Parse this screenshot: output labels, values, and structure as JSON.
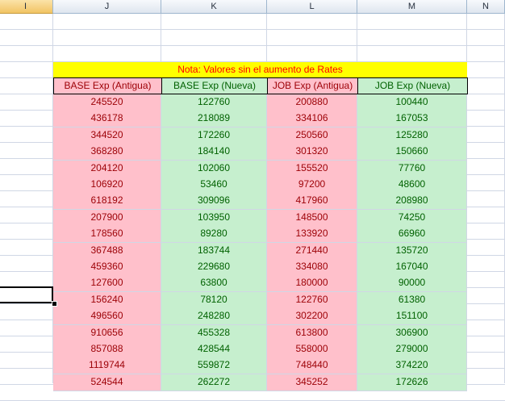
{
  "columns": [
    "I",
    "J",
    "K",
    "L",
    "M",
    "N"
  ],
  "selected_column": "I",
  "note": "Nota: Valores sin el aumento de Rates",
  "headers": [
    "BASE Exp (Antigua)",
    "BASE Exp (Nueva)",
    "JOB Exp (Antigua)",
    "JOB Exp (Nueva)"
  ],
  "rows": [
    [
      "245520",
      "122760",
      "200880",
      "100440"
    ],
    [
      "436178",
      "218089",
      "334106",
      "167053"
    ],
    [
      "344520",
      "172260",
      "250560",
      "125280"
    ],
    [
      "368280",
      "184140",
      "301320",
      "150660"
    ],
    [
      "204120",
      "102060",
      "155520",
      "77760"
    ],
    [
      "106920",
      "53460",
      "97200",
      "48600"
    ],
    [
      "618192",
      "309096",
      "417960",
      "208980"
    ],
    [
      "207900",
      "103950",
      "148500",
      "74250"
    ],
    [
      "178560",
      "89280",
      "133920",
      "66960"
    ],
    [
      "367488",
      "183744",
      "271440",
      "135720"
    ],
    [
      "459360",
      "229680",
      "334080",
      "167040"
    ],
    [
      "127600",
      "63800",
      "180000",
      "90000"
    ],
    [
      "156240",
      "78120",
      "122760",
      "61380"
    ],
    [
      "496560",
      "248280",
      "302200",
      "151100"
    ],
    [
      "910656",
      "455328",
      "613800",
      "306900"
    ],
    [
      "857088",
      "428544",
      "558000",
      "279000"
    ],
    [
      "1119744",
      "559872",
      "748440",
      "374220"
    ],
    [
      "524544",
      "262272",
      "345252",
      "172626"
    ]
  ]
}
